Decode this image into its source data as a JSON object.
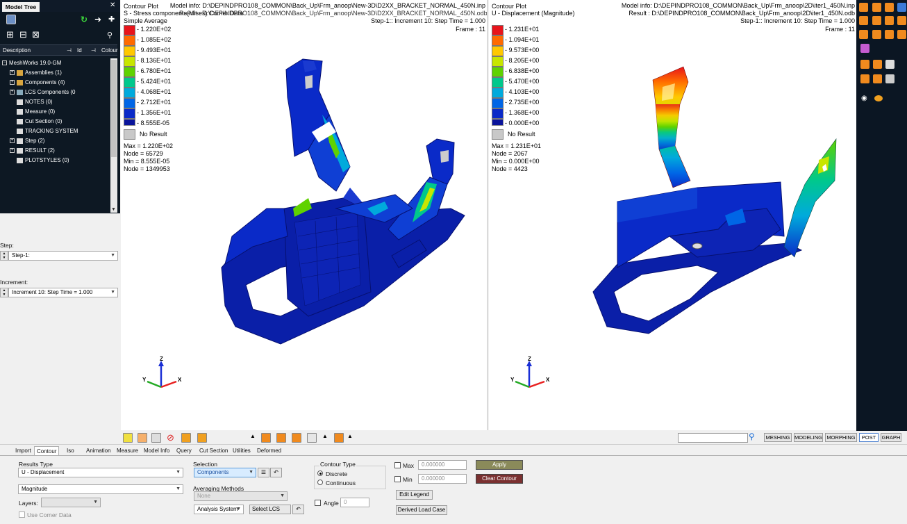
{
  "model_tree": {
    "tab_label": "Model Tree",
    "columns": [
      "Description",
      "Id",
      "Colour"
    ],
    "root": "MeshWorks 19.0-GM",
    "items": [
      "Assemblies (1)",
      "Components (4)",
      "LCS Components (0",
      "NOTES (0)",
      "Measure (0)",
      "Cut Section (0)",
      "TRACKING SYSTEM",
      "Step (2)",
      "RESULT (2)",
      "PLOTSTYLES (0)"
    ]
  },
  "step": {
    "label": "Step:",
    "value": "Step-1:"
  },
  "increment": {
    "label": "Increment:",
    "value": "Increment    10: Step Time =    1.000"
  },
  "viewport1": {
    "title": "Contour Plot",
    "subtitle": "S - Stress components(Mises) Corner Data",
    "result_overlay": "Result : D:\\DEPINDPRO108_COMMON\\Back_Up\\Frm_anoop\\New-3D\\D2XX_BRACKET_NORMAL_450N.odb",
    "averaging": "Simple Average",
    "model_info": "Model info: D:\\DEPINDPRO108_COMMON\\Back_Up\\Frm_anoop\\New-3D\\D2XX_BRACKET_NORMAL_450N.inp",
    "step_info": "Step-1:: Increment      10: Step Time =      1.000",
    "frame": "Frame : 11",
    "legend": [
      "1.220E+02",
      "1.085E+02",
      "9.493E+01",
      "8.136E+01",
      "6.780E+01",
      "5.424E+01",
      "4.068E+01",
      "2.712E+01",
      "1.356E+01",
      "8.555E-05"
    ],
    "no_result": "No Result",
    "stats": [
      "Max = 1.220E+02",
      "Node = 65729",
      "Min = 8.555E-05",
      "Node = 1349953"
    ],
    "axes": {
      "z": "Z",
      "y": "Y",
      "x": "X"
    }
  },
  "viewport2": {
    "title": "Contour Plot",
    "subtitle": "U - Displacement (Magnitude)",
    "model_info": "Model info: D:\\DEPINDPRO108_COMMON\\Back_Up\\Frm_anoop\\2D\\iter1_450N.inp",
    "result": "Result : D:\\DEPINDPRO108_COMMON\\Back_Up\\Frm_anoop\\2D\\iter1_450N.odb",
    "step_info": "Step-1:: Increment      10: Step Time =      1.000",
    "frame": "Frame : 11",
    "legend": [
      "1.231E+01",
      "1.094E+01",
      "9.573E+00",
      "8.205E+00",
      "6.838E+00",
      "5.470E+00",
      "4.103E+00",
      "2.735E+00",
      "1.368E+00",
      "0.000E+00"
    ],
    "no_result": "No Result",
    "stats": [
      "Max = 1.231E+01",
      "Node = 2067",
      "Min = 0.000E+00",
      "Node = 4423"
    ],
    "axes": {
      "z": "Z",
      "y": "Y",
      "x": "X"
    }
  },
  "legend_colors": [
    "#e8141b",
    "#ff6a00",
    "#ffc800",
    "#c8e600",
    "#5fd200",
    "#00c88c",
    "#00aadc",
    "#0066e6",
    "#0a2ac8",
    "#0a149b"
  ],
  "mode_buttons": [
    "MESHING",
    "MODELING",
    "MORPHING",
    "POST",
    "GRAPH"
  ],
  "active_mode": "POST",
  "tabs": [
    "Import",
    "Contour",
    "Iso",
    "Animation",
    "Measure",
    "Model Info",
    "Query",
    "Cut Section",
    "Utilities",
    "Deformed"
  ],
  "active_tab": "Contour",
  "contour_panel": {
    "results_type_label": "Results Type",
    "results_type": "U - Displacement",
    "component": "Magnitude",
    "layers_label": "Layers:",
    "use_corner_data": "Use Corner Data",
    "selection_label": "Selection",
    "selection": "Components",
    "averaging_label": "Averaging Methods",
    "averaging": "None",
    "analysis_system": "Analysis System",
    "select_lcs": "Select LCS",
    "contour_type_label": "Contour Type",
    "discrete": "Discrete",
    "continuous": "Continuous",
    "angle_label": "Angle",
    "angle_value": "0",
    "max_label": "Max",
    "max_value": "0.000000",
    "min_label": "Min",
    "min_value": "0.000000",
    "edit_legend": "Edit Legend",
    "derived_load_case": "Derived Load Case",
    "apply": "Apply",
    "clear_contour": "Clear Contour"
  }
}
